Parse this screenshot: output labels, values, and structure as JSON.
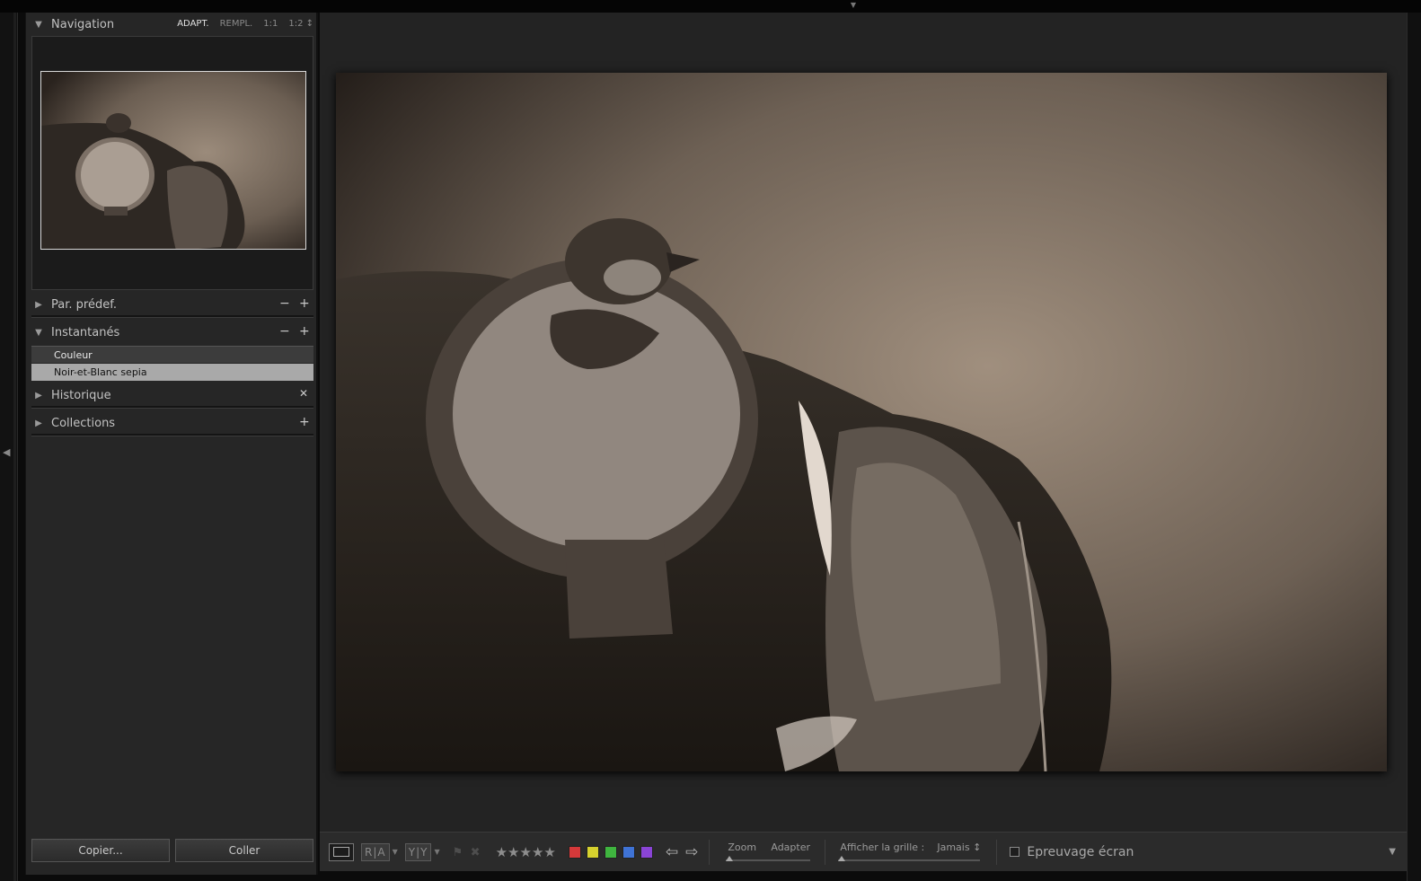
{
  "navigator": {
    "title": "Navigation",
    "zoom_options": [
      "ADAPT.",
      "REMPL.",
      "1:1",
      "1:2 ↕"
    ]
  },
  "presets": {
    "title": "Par. prédef."
  },
  "snapshots": {
    "title": "Instantanés",
    "items": [
      "Couleur",
      "Noir-et-Blanc sepia"
    ]
  },
  "history": {
    "title": "Historique"
  },
  "collections": {
    "title": "Collections"
  },
  "buttons": {
    "copy": "Copier...",
    "paste": "Coller"
  },
  "toolbar": {
    "compare": "R|A",
    "survey": "Y|Y",
    "zoom_label": "Zoom",
    "zoom_value": "Adapter",
    "grid_label": "Afficher la grille :",
    "grid_value": "Jamais ↕",
    "softproof_label": "Epreuvage écran",
    "stars": "★★★★★",
    "label_colors": [
      "#d6393a",
      "#d6d12e",
      "#3fb53f",
      "#3f73d6",
      "#8a44d6"
    ]
  },
  "colors": {
    "panel_bg": "#262626",
    "main_bg": "#232323",
    "selected_snapshot_bg": "#a9a9a9"
  }
}
